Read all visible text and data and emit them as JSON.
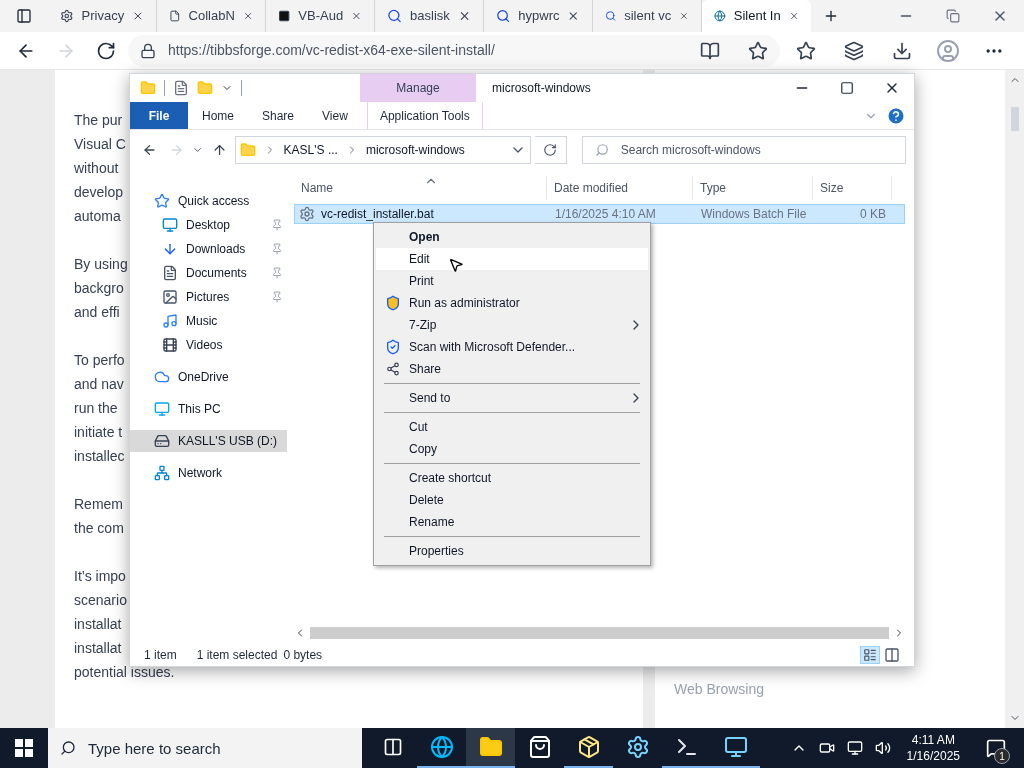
{
  "browser": {
    "tabs": [
      {
        "label": "Privacy",
        "selected": false
      },
      {
        "label": "CollabN",
        "selected": false
      },
      {
        "label": "VB-Aud",
        "selected": false
      },
      {
        "label": "baslisk",
        "selected": false
      },
      {
        "label": "hypwrc",
        "selected": false
      },
      {
        "label": "silent vc",
        "selected": false
      },
      {
        "label": "Silent In",
        "selected": true
      }
    ],
    "url": "https://tibbsforge.com/vc-redist-x64-exe-silent-install/"
  },
  "article": {
    "paragraphs": [
      [
        "The pur",
        "Visual C",
        "without",
        "develop",
        "automa"
      ],
      [
        "By using",
        "backgro",
        "and effi"
      ],
      [
        "To perfo",
        "and nav",
        "run the",
        "initiate t",
        "installec"
      ],
      [
        "Remem",
        "the com"
      ],
      [
        "It’s impo",
        "scenario",
        "installat",
        "installat",
        "potential issues."
      ]
    ]
  },
  "sidebar": {
    "label": "Web Browsing"
  },
  "explorer": {
    "title": "microsoft-windows",
    "context_group": "Manage",
    "ribbon_tabs": [
      {
        "label": "File",
        "kind": "file",
        "selected": true
      },
      {
        "label": "Home",
        "kind": "tab",
        "selected": false
      },
      {
        "label": "Share",
        "kind": "tab",
        "selected": false
      },
      {
        "label": "View",
        "kind": "tab",
        "selected": false
      },
      {
        "label": "Application Tools",
        "kind": "contextual",
        "selected": false
      }
    ],
    "path": [
      "KASL'S ...",
      "microsoft-windows"
    ],
    "search": {
      "placeholder": "Search microsoft-windows"
    },
    "nav": [
      {
        "label": "Quick access",
        "selected": false,
        "children": [
          {
            "label": "Desktop",
            "pinned": true,
            "selected": false
          },
          {
            "label": "Downloads",
            "pinned": true,
            "selected": false
          },
          {
            "label": "Documents",
            "pinned": true,
            "selected": false
          },
          {
            "label": "Pictures",
            "pinned": true,
            "selected": false
          },
          {
            "label": "Music",
            "pinned": false,
            "selected": false
          },
          {
            "label": "Videos",
            "pinned": false,
            "selected": false
          }
        ]
      },
      {
        "label": "OneDrive",
        "selected": false
      },
      {
        "label": "This PC",
        "selected": false
      },
      {
        "label": "KASLL'S USB (D:)",
        "selected": true
      },
      {
        "label": "Network",
        "selected": false
      }
    ],
    "columns": [
      "Name",
      "Date modified",
      "Type",
      "Size"
    ],
    "files": [
      {
        "name": "vc-redist_installer.bat",
        "date": "1/16/2025 4:10 AM",
        "type": "Windows Batch File",
        "size": "0 KB",
        "selected": true
      }
    ],
    "status": [
      "1 item",
      "1 item selected",
      "0 bytes"
    ]
  },
  "context_menu": [
    {
      "kind": "item",
      "label": "Open",
      "bold": true,
      "hovered": false,
      "submenu": false
    },
    {
      "kind": "item",
      "label": "Edit",
      "bold": false,
      "hovered": true,
      "submenu": false
    },
    {
      "kind": "item",
      "label": "Print",
      "bold": false,
      "hovered": false,
      "submenu": false
    },
    {
      "kind": "item",
      "label": "Run as administrator",
      "bold": false,
      "hovered": false,
      "submenu": false
    },
    {
      "kind": "item",
      "label": "7-Zip",
      "bold": false,
      "hovered": false,
      "submenu": true
    },
    {
      "kind": "item",
      "label": "Scan with Microsoft Defender...",
      "bold": false,
      "hovered": false,
      "submenu": false
    },
    {
      "kind": "item",
      "label": "Share",
      "bold": false,
      "hovered": false,
      "submenu": false
    },
    {
      "kind": "separator"
    },
    {
      "kind": "item",
      "label": "Send to",
      "bold": false,
      "hovered": false,
      "submenu": true
    },
    {
      "kind": "separator"
    },
    {
      "kind": "item",
      "label": "Cut",
      "bold": false,
      "hovered": false,
      "submenu": false
    },
    {
      "kind": "item",
      "label": "Copy",
      "bold": false,
      "hovered": false,
      "submenu": false
    },
    {
      "kind": "separator"
    },
    {
      "kind": "item",
      "label": "Create shortcut",
      "bold": false,
      "hovered": false,
      "submenu": false
    },
    {
      "kind": "item",
      "label": "Delete",
      "bold": false,
      "hovered": false,
      "submenu": false
    },
    {
      "kind": "item",
      "label": "Rename",
      "bold": false,
      "hovered": false,
      "submenu": false
    },
    {
      "kind": "separator"
    },
    {
      "kind": "item",
      "label": "Properties",
      "bold": false,
      "hovered": false,
      "submenu": false
    }
  ],
  "taskbar": {
    "search": {
      "placeholder": "Type here to search"
    },
    "apps": [
      {
        "running": false,
        "selected": false
      },
      {
        "running": true,
        "selected": false
      },
      {
        "running": true,
        "selected": true
      },
      {
        "running": false,
        "selected": false
      },
      {
        "running": true,
        "selected": false
      },
      {
        "running": false,
        "selected": false
      },
      {
        "running": true,
        "selected": false
      },
      {
        "running": true,
        "selected": false
      }
    ],
    "time": "4:11 AM",
    "date": "1/16/2025",
    "notifications": "1"
  }
}
